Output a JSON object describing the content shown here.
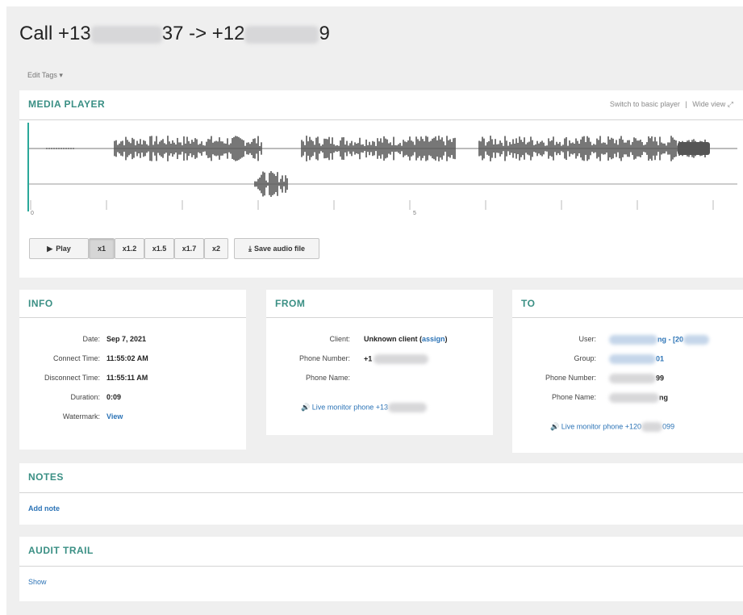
{
  "header": {
    "title_prefix": "Call +13",
    "title_mid": "37 -> +12",
    "title_suffix": "9",
    "edit_tags": "Edit Tags ▾"
  },
  "media_player": {
    "title": "MEDIA PLAYER",
    "switch_label": "Switch to basic player",
    "separator": "|",
    "wide_view_label": "Wide view",
    "axis_start": "0",
    "axis_mid": "5",
    "play_label": "Play",
    "speeds": [
      "x1",
      "x1.2",
      "x1.5",
      "x1.7",
      "x2"
    ],
    "active_speed": "x1",
    "save_label": "Save audio file"
  },
  "info": {
    "title": "INFO",
    "rows": [
      {
        "label": "Date:",
        "value": "Sep 7, 2021"
      },
      {
        "label": "Connect Time:",
        "value": "11:55:02 AM"
      },
      {
        "label": "Disconnect Time:",
        "value": "11:55:11 AM"
      },
      {
        "label": "Duration:",
        "value": "0:09"
      },
      {
        "label": "Watermark:",
        "value": "View"
      }
    ]
  },
  "from": {
    "title": "FROM",
    "client_label": "Client:",
    "client_value": "Unknown client",
    "assign_label": "assign",
    "phone_number_label": "Phone Number:",
    "phone_number_value": "+1",
    "phone_name_label": "Phone Name:",
    "live_monitor": "Live monitor phone +13"
  },
  "to": {
    "title": "TO",
    "user_label": "User:",
    "user_value": "ng - [20",
    "group_label": "Group:",
    "group_value": "01",
    "phone_number_label": "Phone Number:",
    "phone_number_value": "99",
    "phone_name_label": "Phone Name:",
    "phone_name_value": "ng",
    "live_monitor_prefix": "Live monitor phone +120",
    "live_monitor_suffix": "099"
  },
  "notes": {
    "title": "NOTES",
    "add_note": "Add note"
  },
  "audit": {
    "title": "AUDIT TRAIL",
    "show": "Show"
  },
  "colors": {
    "accent": "#3a8f84",
    "link": "#2b73b6",
    "waveform": "#555555",
    "playhead": "#2aa89a"
  }
}
